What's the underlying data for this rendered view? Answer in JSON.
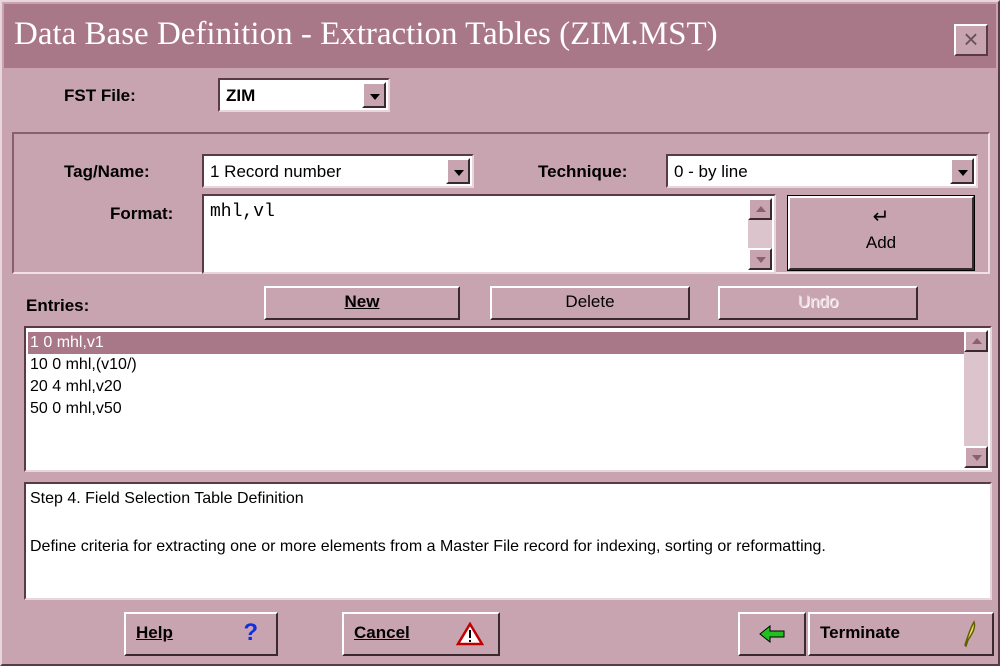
{
  "window": {
    "title": "Data Base Definition - Extraction Tables (ZIM.MST)",
    "close_label": "×"
  },
  "fst": {
    "label": "FST File:",
    "value": "ZIM"
  },
  "tag": {
    "label": "Tag/Name:",
    "value": "1 Record number"
  },
  "technique": {
    "label": "Technique:",
    "value": "0 - by line"
  },
  "format": {
    "label": "Format:",
    "value": "mhl,vl"
  },
  "add": {
    "label": "Add",
    "icon": "enter-arrow-icon"
  },
  "entries": {
    "label": "Entries:",
    "new_label": "New",
    "delete_label": "Delete",
    "undo_label": "Undo",
    "items": [
      "1 0 mhl,v1",
      "10 0 mhl,(v10/)",
      "20 4 mhl,v20",
      "50 0 mhl,v50"
    ],
    "selected_index": 0
  },
  "info": {
    "step": "Step 4. Field Selection Table Definition",
    "description": "Define criteria for extracting one or more elements from a Master File record for indexing, sorting or reformatting."
  },
  "footer": {
    "help_label": "Help",
    "help_icon": "question-icon",
    "cancel_label": "Cancel",
    "cancel_icon": "warning-icon",
    "back_icon": "back-arrow-icon",
    "terminate_label": "Terminate",
    "terminate_icon": "quill-icon"
  },
  "colors": {
    "background": "#c8a4b0",
    "titlebar": "#a87888",
    "selection": "#a87888"
  }
}
